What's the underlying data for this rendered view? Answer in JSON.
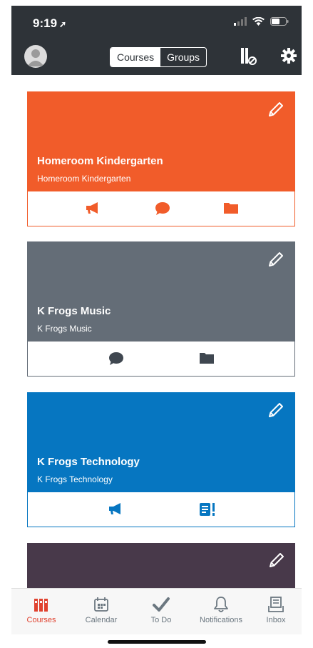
{
  "status": {
    "time": "9:19"
  },
  "nav": {
    "segments": [
      "Courses",
      "Groups"
    ],
    "active_segment": "Courses"
  },
  "courses": [
    {
      "title": "Homeroom Kindergarten",
      "subtitle": "Homeroom Kindergarten",
      "color": "#f15c2a",
      "actions": [
        "announcements-icon",
        "discussions-icon",
        "files-icon"
      ]
    },
    {
      "title": "K Frogs Music",
      "subtitle": "K Frogs Music",
      "color": "#646d77",
      "actions": [
        "discussions-icon",
        "files-icon"
      ]
    },
    {
      "title": "K Frogs Technology",
      "subtitle": "K Frogs Technology",
      "color": "#0676c1",
      "actions": [
        "announcements-icon",
        "assignments-icon"
      ]
    },
    {
      "title": "",
      "subtitle": "",
      "color": "#48394a",
      "actions": []
    }
  ],
  "tab_bar": {
    "items": [
      {
        "label": "Courses",
        "icon": "courses-icon",
        "active": true
      },
      {
        "label": "Calendar",
        "icon": "calendar-icon",
        "active": false
      },
      {
        "label": "To Do",
        "icon": "checkmark-icon",
        "active": false
      },
      {
        "label": "Notifications",
        "icon": "bell-icon",
        "active": false
      },
      {
        "label": "Inbox",
        "icon": "inbox-icon",
        "active": false
      }
    ]
  },
  "colors": {
    "accent": "#e0422f",
    "nav_bg": "#2e3338"
  }
}
